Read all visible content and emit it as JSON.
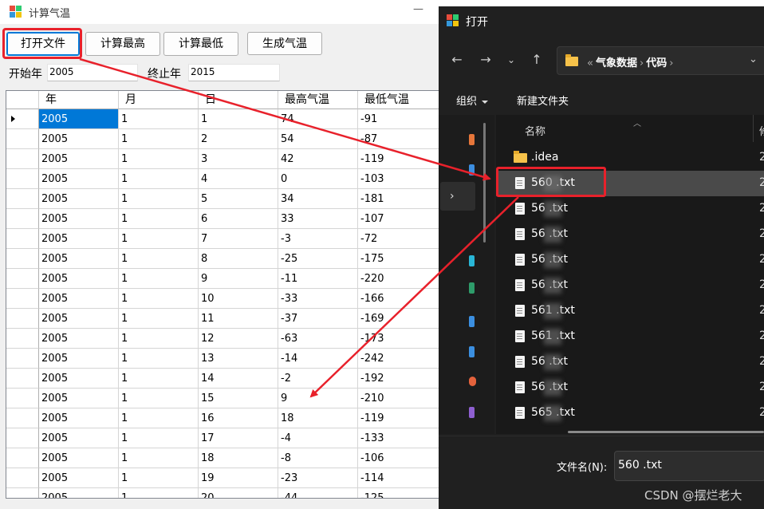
{
  "app": {
    "title": "计算气温",
    "buttons": {
      "open": "打开文件",
      "max": "计算最高",
      "min": "计算最低",
      "gen": "生成气温"
    },
    "start_label": "开始年",
    "start_value": "2005",
    "end_label": "终止年",
    "end_value": "2015",
    "grid": {
      "headers": [
        "年",
        "月",
        "日",
        "最高气温",
        "最低气温"
      ],
      "rows": [
        [
          "2005",
          "1",
          "1",
          "74",
          "-91"
        ],
        [
          "2005",
          "1",
          "2",
          "54",
          "-87"
        ],
        [
          "2005",
          "1",
          "3",
          "42",
          "-119"
        ],
        [
          "2005",
          "1",
          "4",
          "0",
          "-103"
        ],
        [
          "2005",
          "1",
          "5",
          "34",
          "-181"
        ],
        [
          "2005",
          "1",
          "6",
          "33",
          "-107"
        ],
        [
          "2005",
          "1",
          "7",
          "-3",
          "-72"
        ],
        [
          "2005",
          "1",
          "8",
          "-25",
          "-175"
        ],
        [
          "2005",
          "1",
          "9",
          "-11",
          "-220"
        ],
        [
          "2005",
          "1",
          "10",
          "-33",
          "-166"
        ],
        [
          "2005",
          "1",
          "11",
          "-37",
          "-169"
        ],
        [
          "2005",
          "1",
          "12",
          "-63",
          "-173"
        ],
        [
          "2005",
          "1",
          "13",
          "-14",
          "-242"
        ],
        [
          "2005",
          "1",
          "14",
          "-2",
          "-192"
        ],
        [
          "2005",
          "1",
          "15",
          "9",
          "-210"
        ],
        [
          "2005",
          "1",
          "16",
          "18",
          "-119"
        ],
        [
          "2005",
          "1",
          "17",
          "-4",
          "-133"
        ],
        [
          "2005",
          "1",
          "18",
          "-8",
          "-106"
        ],
        [
          "2005",
          "1",
          "19",
          "-23",
          "-114"
        ],
        [
          "2005",
          "1",
          "20",
          "-44",
          "-125"
        ]
      ]
    }
  },
  "dialog": {
    "title": "打开",
    "path_prefix": "«",
    "path": [
      "气象数据",
      "代码"
    ],
    "organize": "组织",
    "new_folder": "新建文件夹",
    "column_name": "名称",
    "column_2": "修",
    "files": [
      {
        "name": ".idea",
        "type": "folder",
        "col2": "2"
      },
      {
        "name": "560  .txt",
        "type": "file",
        "col2": "2"
      },
      {
        "name": "56    .txt",
        "type": "file",
        "col2": "2"
      },
      {
        "name": "56    .txt",
        "type": "file",
        "col2": "2"
      },
      {
        "name": "56    .txt",
        "type": "file",
        "col2": "2"
      },
      {
        "name": "56    .txt",
        "type": "file",
        "col2": "2"
      },
      {
        "name": "561   .txt",
        "type": "file",
        "col2": "2"
      },
      {
        "name": "561   .txt",
        "type": "file",
        "col2": "2"
      },
      {
        "name": "56    .txt",
        "type": "file",
        "col2": "2"
      },
      {
        "name": "56    .txt",
        "type": "file",
        "col2": "2"
      },
      {
        "name": "565   .txt",
        "type": "file",
        "col2": "2"
      }
    ],
    "filename_label": "文件名(N):",
    "filename_value": "560   .txt"
  },
  "watermark": "CSDN @摆烂老大",
  "colors": {
    "accent": "#0078d7",
    "highlight": "#e8212b",
    "dialog_bg": "#202020"
  }
}
